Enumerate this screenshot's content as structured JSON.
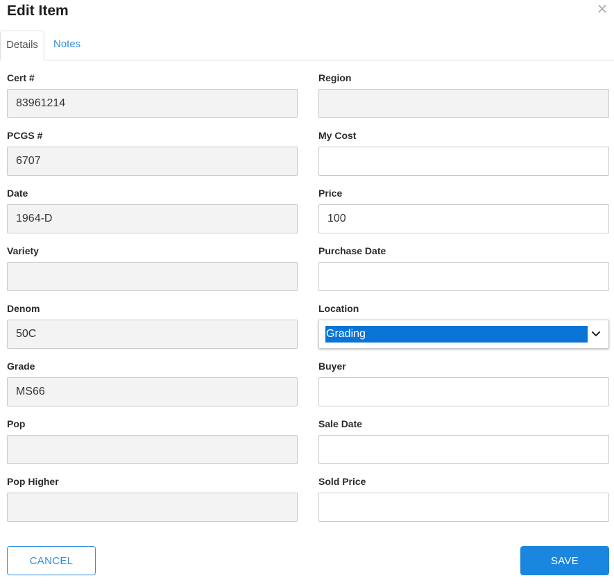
{
  "dialog": {
    "title": "Edit Item",
    "close_glyph": "×"
  },
  "tabs": [
    {
      "label": "Details",
      "active": true
    },
    {
      "label": "Notes",
      "active": false
    }
  ],
  "left_fields": [
    {
      "label": "Cert #",
      "value": "83961214",
      "readonly": true
    },
    {
      "label": "PCGS #",
      "value": "6707",
      "readonly": true
    },
    {
      "label": "Date",
      "value": "1964-D",
      "readonly": true
    },
    {
      "label": "Variety",
      "value": "",
      "readonly": true
    },
    {
      "label": "Denom",
      "value": "50C",
      "readonly": true
    },
    {
      "label": "Grade",
      "value": "MS66",
      "readonly": true
    },
    {
      "label": "Pop",
      "value": "",
      "readonly": true
    },
    {
      "label": "Pop Higher",
      "value": "",
      "readonly": true
    }
  ],
  "right_fields": [
    {
      "label": "Region",
      "value": "",
      "readonly": true
    },
    {
      "label": "My Cost",
      "value": "",
      "readonly": false
    },
    {
      "label": "Price",
      "value": "100",
      "readonly": false
    },
    {
      "label": "Purchase Date",
      "value": "",
      "readonly": false
    },
    {
      "label": "Location",
      "value": "Grading",
      "type": "select"
    },
    {
      "label": "Buyer",
      "value": "",
      "readonly": false
    },
    {
      "label": "Sale Date",
      "value": "",
      "readonly": false
    },
    {
      "label": "Sold Price",
      "value": "",
      "readonly": false
    }
  ],
  "buttons": {
    "cancel": "CANCEL",
    "save": "SAVE"
  },
  "colors": {
    "accent": "#2f8fdc",
    "save_bg": "#1a86e0",
    "select_highlight": "#0a74d6",
    "readonly_bg": "#f3f3f3"
  },
  "icons": {
    "close": "close-icon",
    "select_arrow": "chevron-down-icon"
  }
}
